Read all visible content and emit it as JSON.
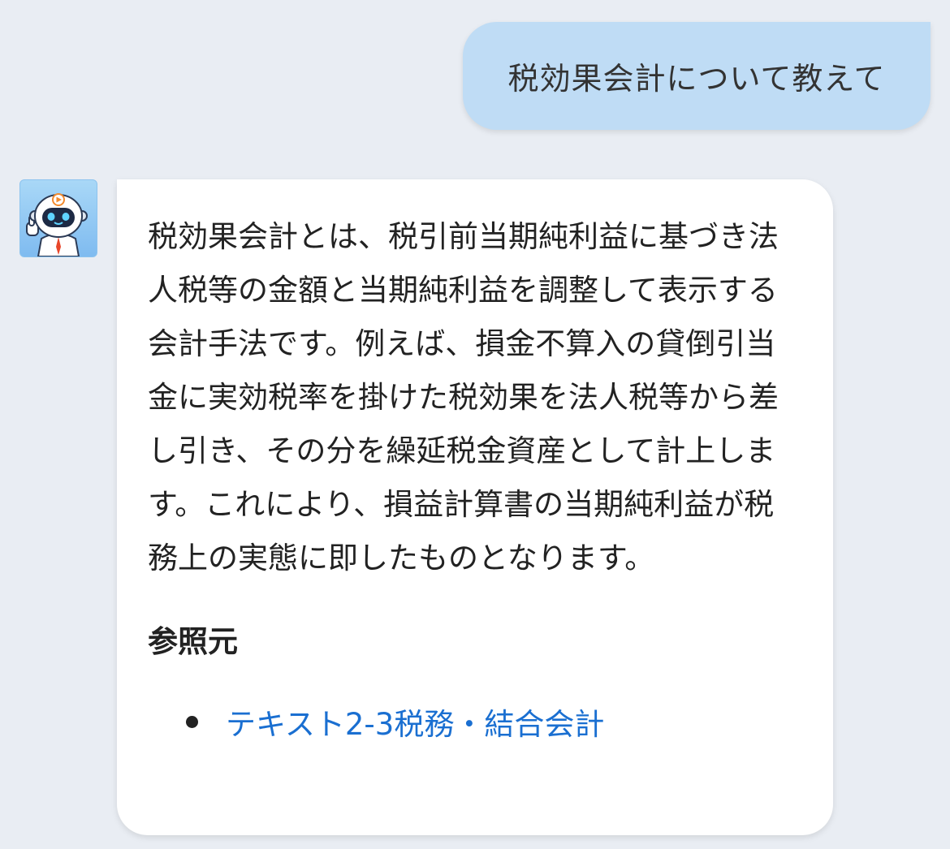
{
  "user_message": {
    "text": "税効果会計について教えて"
  },
  "bot_message": {
    "avatar_icon": "robot-avatar-icon",
    "answer": "税効果会計とは、税引前当期純利益に基づき法人税等の金額と当期純利益を調整して表示する会計手法です。例えば、損金不算入の貸倒引当金に実効税率を掛けた税効果を法人税等から差し引き、その分を繰延税金資産として計上します。これにより、損益計算書の当期純利益が税務上の実態に即したものとなります。",
    "reference_heading": "参照元",
    "references": [
      {
        "label": "テキスト2-3税務・結合会計"
      }
    ]
  },
  "colors": {
    "background": "#e9edf3",
    "user_bubble": "#bfdcf5",
    "bot_bubble": "#ffffff",
    "link": "#1a6fd1"
  }
}
